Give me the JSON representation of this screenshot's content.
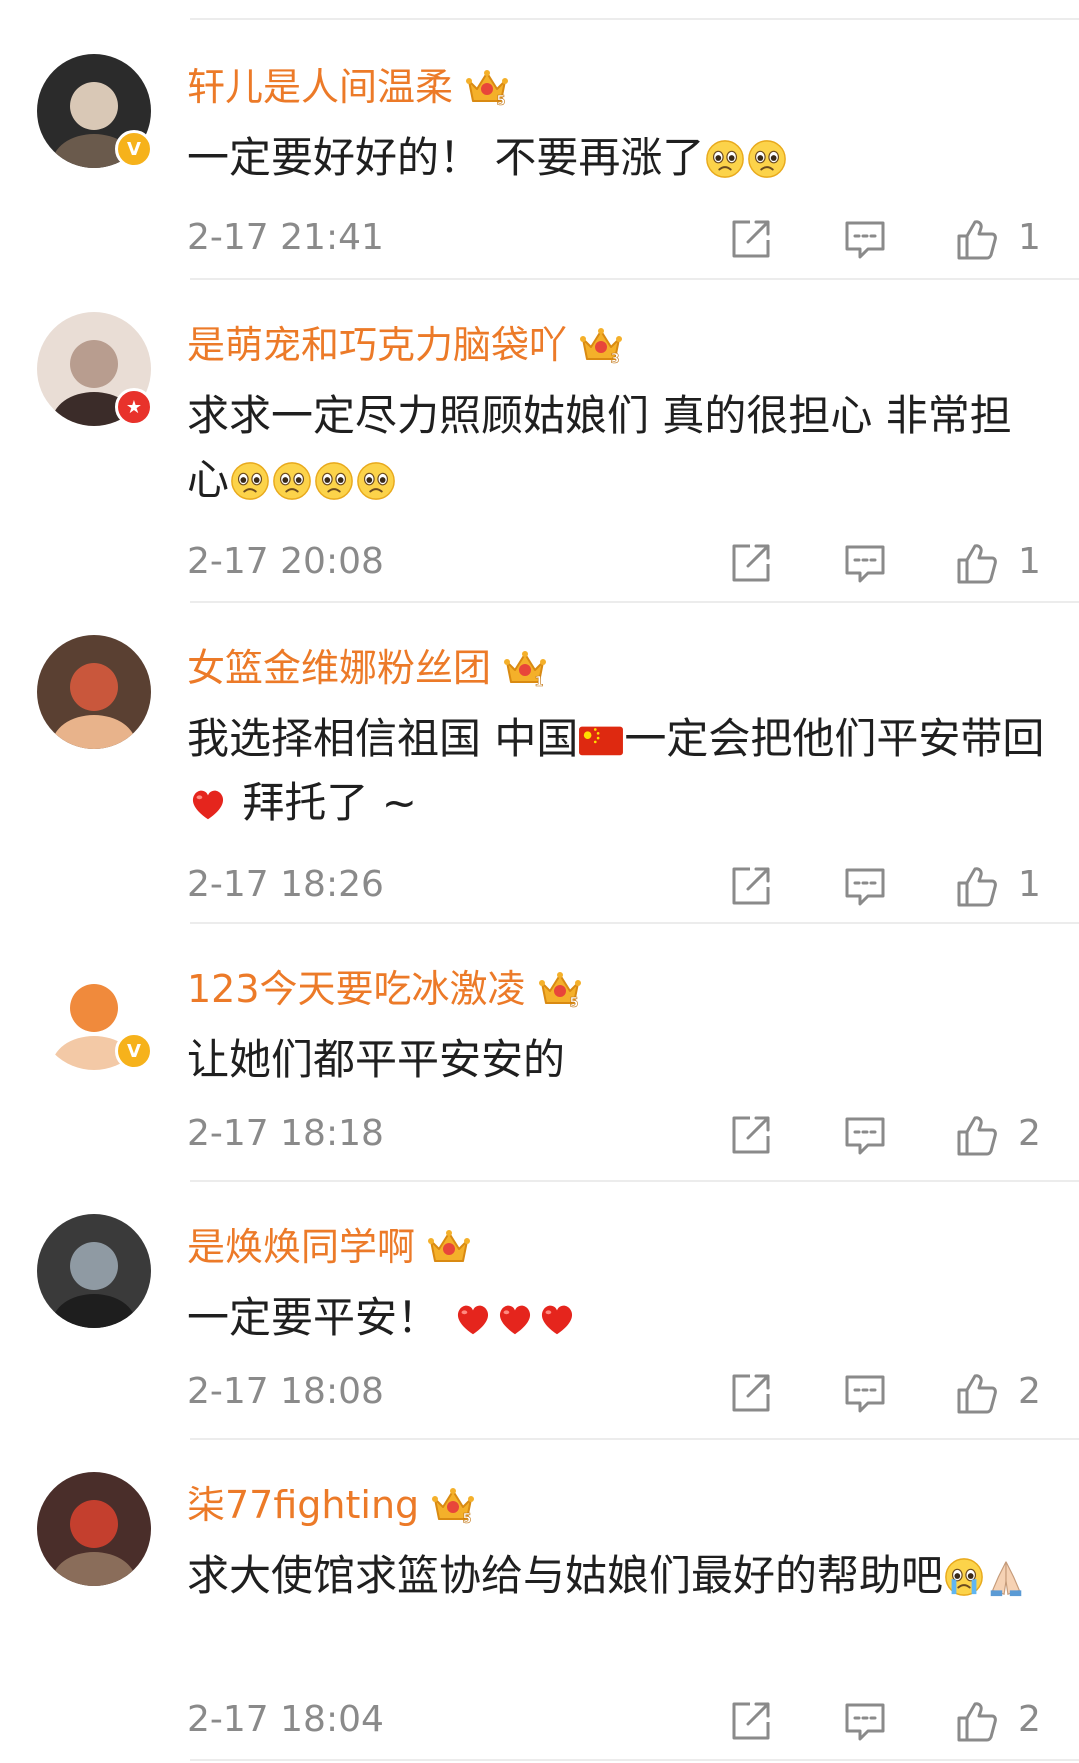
{
  "colors": {
    "username": "#ec7a28",
    "text": "#1f1f1f",
    "meta": "#8a8a8a",
    "divider": "#ececec"
  },
  "comments": [
    {
      "username": "轩儿是人间温柔",
      "crown_level": "5",
      "badge": "V",
      "text_segments": [
        {
          "type": "text",
          "value": "一定要好好的！ 不要再涨了"
        },
        {
          "type": "emoji",
          "name": "sad-face-emoji"
        },
        {
          "type": "emoji",
          "name": "sad-face-emoji"
        }
      ],
      "time": "2-17 21:41",
      "likes": "1"
    },
    {
      "username": "是萌宠和巧克力脑袋吖",
      "crown_level": "3",
      "badge": "star",
      "text_segments": [
        {
          "type": "text",
          "value": "求求一定尽力照顾姑娘们 真的很担心 非常担心"
        },
        {
          "type": "emoji",
          "name": "sad-face-emoji"
        },
        {
          "type": "emoji",
          "name": "sad-face-emoji"
        },
        {
          "type": "emoji",
          "name": "sad-face-emoji"
        },
        {
          "type": "emoji",
          "name": "sad-face-emoji"
        }
      ],
      "time": "2-17 20:08",
      "likes": "1"
    },
    {
      "username": "女篮金维娜粉丝团",
      "crown_level": "1",
      "badge": "",
      "text_segments": [
        {
          "type": "text",
          "value": "我选择相信祖国 中国"
        },
        {
          "type": "emoji",
          "name": "china-flag-emoji"
        },
        {
          "type": "text",
          "value": "一定会把他们平安带回"
        },
        {
          "type": "emoji",
          "name": "red-heart-emoji"
        },
        {
          "type": "text",
          "value": " 拜托了 ~"
        }
      ],
      "time": "2-17 18:26",
      "likes": "1"
    },
    {
      "username": "123今天要吃冰激凌",
      "crown_level": "5",
      "badge": "V",
      "text_segments": [
        {
          "type": "text",
          "value": "让她们都平平安安的"
        }
      ],
      "time": "2-17 18:18",
      "likes": "2"
    },
    {
      "username": "是焕焕同学啊",
      "crown_level": "",
      "badge": "",
      "text_segments": [
        {
          "type": "text",
          "value": "一定要平安！ "
        },
        {
          "type": "emoji",
          "name": "red-heart-emoji"
        },
        {
          "type": "emoji",
          "name": "red-heart-emoji"
        },
        {
          "type": "emoji",
          "name": "red-heart-emoji"
        }
      ],
      "time": "2-17 18:08",
      "likes": "2"
    },
    {
      "username": "柒77fighting",
      "crown_level": "5",
      "badge": "",
      "text_segments": [
        {
          "type": "text",
          "value": "求大使馆求篮协给与姑娘们最好的帮助吧"
        },
        {
          "type": "emoji",
          "name": "crying-face-emoji"
        },
        {
          "type": "emoji",
          "name": "praying-hands-emoji"
        }
      ],
      "time": "2-17 18:04",
      "likes": "2"
    }
  ]
}
